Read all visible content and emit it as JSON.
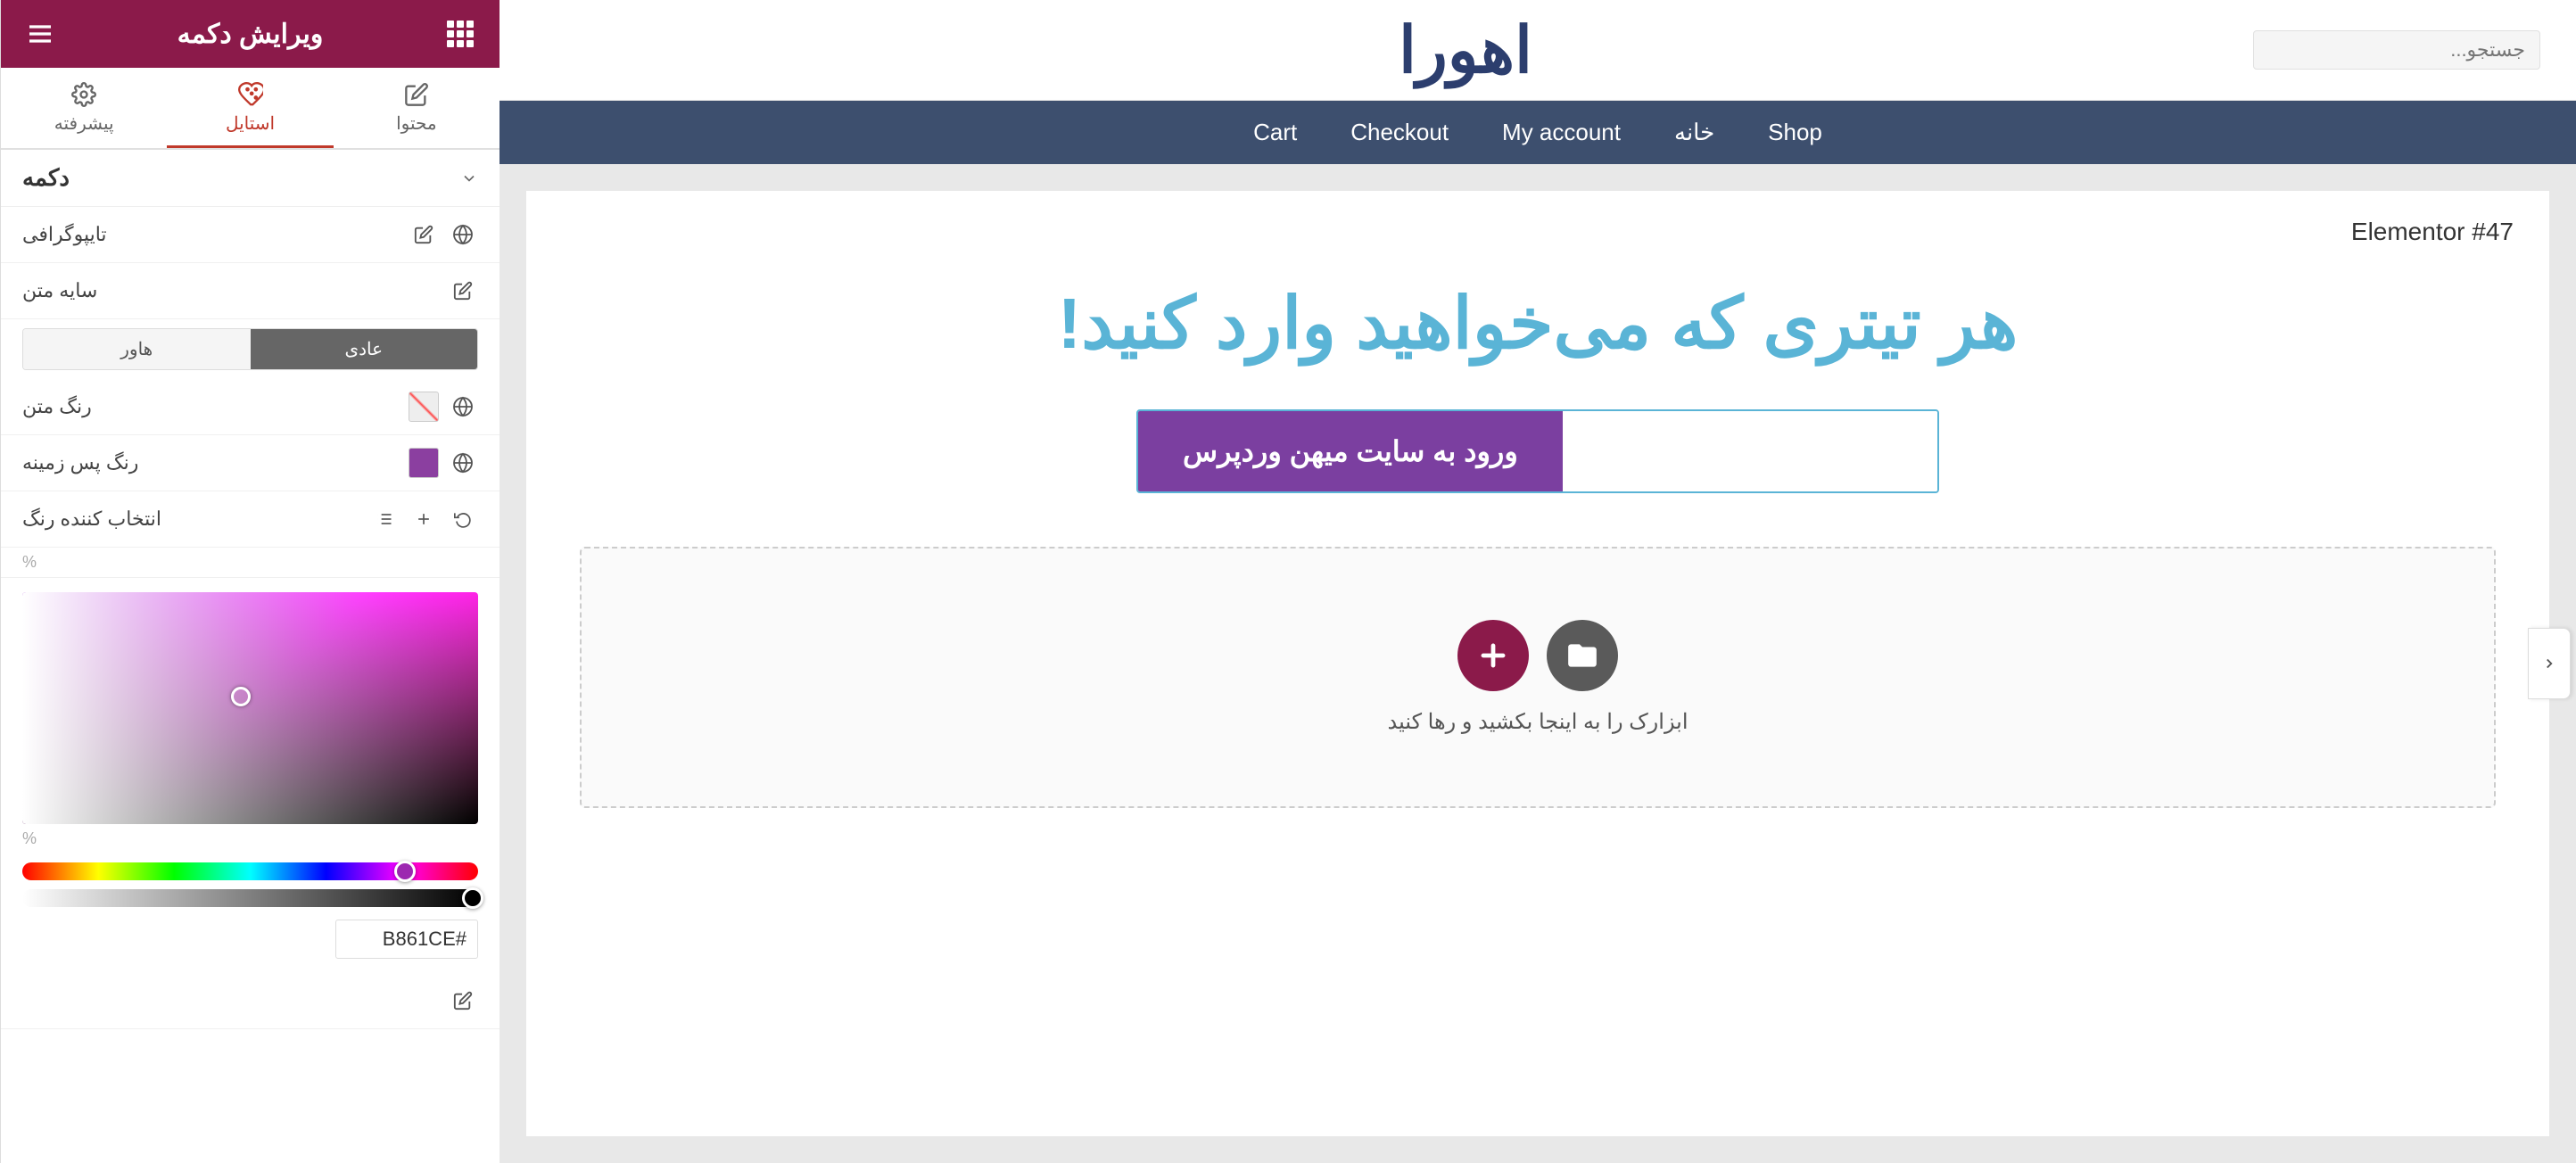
{
  "top_bar": {
    "search_placeholder": "جستجو...",
    "logo_text": "اهورا"
  },
  "nav": {
    "items": [
      {
        "label": "Cart",
        "href": "#"
      },
      {
        "label": "Checkout",
        "href": "#"
      },
      {
        "label": "My account",
        "href": "#"
      },
      {
        "label": "خانه",
        "href": "#"
      },
      {
        "label": "Shop",
        "href": "#"
      }
    ]
  },
  "editor": {
    "elementor_label": "Elementor #47",
    "hero_heading": "هر تیتری که می‌خواهید وارد کنید!",
    "cta_button_label": "ورود به سایت میهن وردپرس",
    "drop_zone_text": "ابزارک را به اینجا بکشید و رها کنید"
  },
  "panel": {
    "title": "ویرایش دکمه",
    "tabs": [
      {
        "label": "محتوا",
        "icon": "pencil-icon"
      },
      {
        "label": "استایل",
        "icon": "palette-icon",
        "active": true
      },
      {
        "label": "پیشرفته",
        "icon": "gear-icon"
      }
    ],
    "section_title": "دکمه",
    "rows": [
      {
        "label": "تایپوگرافی",
        "has_pencil": true,
        "has_globe": true
      },
      {
        "label": "سایه متن",
        "has_pencil": true
      }
    ],
    "state_tabs": [
      {
        "label": "عادی",
        "active": true
      },
      {
        "label": "هاور"
      }
    ],
    "color_rows": [
      {
        "label": "رنگ متن",
        "has_diagonal": true,
        "has_globe": true
      },
      {
        "label": "رنگ پس زمینه",
        "has_swatch": true,
        "swatch_color": "#8b3fa0",
        "has_globe": true
      }
    ],
    "color_picker": {
      "toolbar_icons": [
        "list-icon",
        "plus-icon",
        "reset-icon"
      ],
      "hex_value": "#B861CE",
      "percent": "%"
    }
  }
}
